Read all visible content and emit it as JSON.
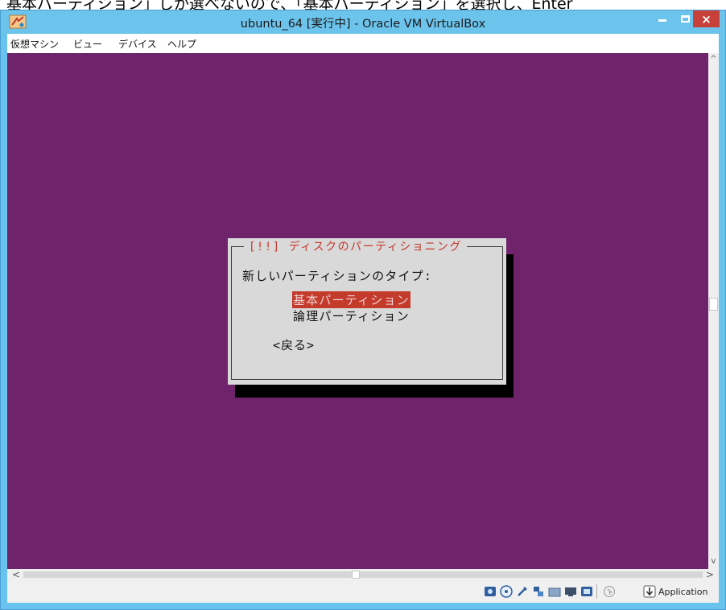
{
  "caption": {
    "text": "基本パーティション」しか選べないので、「基本パーティション」を選択し、Enter"
  },
  "window": {
    "title": "ubuntu_64 [実行中] - Oracle VM VirtualBox",
    "icon": "virtualbox-app-icon",
    "controls": {
      "minimize": "minimize-icon",
      "maximize": "maximize-icon",
      "close": "×"
    }
  },
  "menu": {
    "items": [
      {
        "label": "仮想マシン"
      },
      {
        "label": "ビュー"
      },
      {
        "label": "デバイス"
      },
      {
        "label": "ヘルプ"
      }
    ]
  },
  "dialog": {
    "title": "[!!] ディスクのパーティショニング",
    "prompt": "新しいパーティションのタイプ:",
    "options": [
      {
        "label": "基本パーティション",
        "selected": true
      },
      {
        "label": "論理パーティション",
        "selected": false
      }
    ],
    "back_label": "<戻る>"
  },
  "scrollbars": {
    "up": "^",
    "down": "v",
    "left": "<",
    "right": ">"
  },
  "statusbar": {
    "icons": [
      "hard-disk-icon",
      "optical-drive-icon",
      "usb-icon",
      "network-icon",
      "shared-folder-icon",
      "display-icon",
      "video-capture-icon",
      "mouse-integration-icon",
      "host-key-arrow-icon"
    ],
    "host_key_label": "Application"
  },
  "colors": {
    "vm_background": "#6f236a",
    "titlebar": "#6cc3ec",
    "close_button": "#c7413a",
    "dialog_bg": "#d9d9d9",
    "highlight": "#c43a2b"
  }
}
